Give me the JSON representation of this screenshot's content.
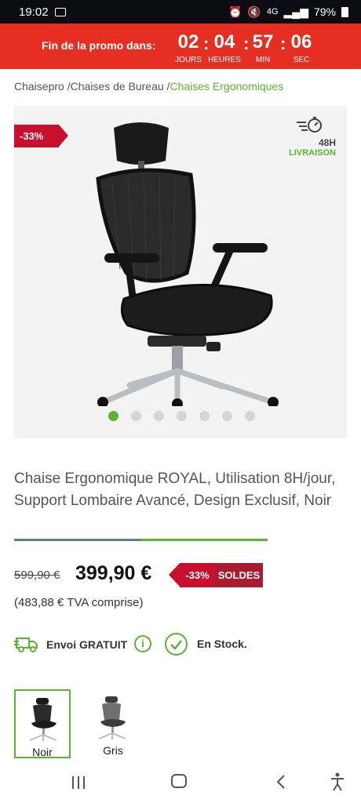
{
  "status_bar": {
    "time": "19:02",
    "network": "4G",
    "battery": "79%"
  },
  "promo": {
    "label": "Fin de la promo dans:",
    "countdown": [
      {
        "value": "02",
        "unit": "JOURS"
      },
      {
        "value": "04",
        "unit": "HEURES"
      },
      {
        "value": "57",
        "unit": "MIN"
      },
      {
        "value": "06",
        "unit": "SEC"
      }
    ]
  },
  "breadcrumb": {
    "items": [
      "Chaisepro /",
      "Chaises de Bureau /"
    ],
    "current": "Chaises Ergonomiques"
  },
  "gallery": {
    "discount_badge": "-33%",
    "delivery_hours": "48H",
    "delivery_label": "LIVRAISON",
    "slide_count": 7,
    "active_slide": 1
  },
  "product": {
    "title": "Chaise Ergonomique ROYAL, Utilisation 8H/jour, Support Lombaire Avancé, Design Exclusif, Noir",
    "old_price": "599,90 €",
    "new_price": "399,90 €",
    "discount_tag": "-33%",
    "sale_tag": "SOLDES",
    "tva_note": "(483,88 € TVA comprise)"
  },
  "shipping": {
    "label": "Envoi GRATUIT",
    "info_icon": "i",
    "stock_label": "En Stock."
  },
  "variants": [
    {
      "label": "Noir",
      "selected": true
    },
    {
      "label": "Gris",
      "selected": false
    }
  ],
  "colors": {
    "promo_red": "#e42f22",
    "accent_green": "#5bb52e",
    "discount_red": "#c8102e"
  }
}
